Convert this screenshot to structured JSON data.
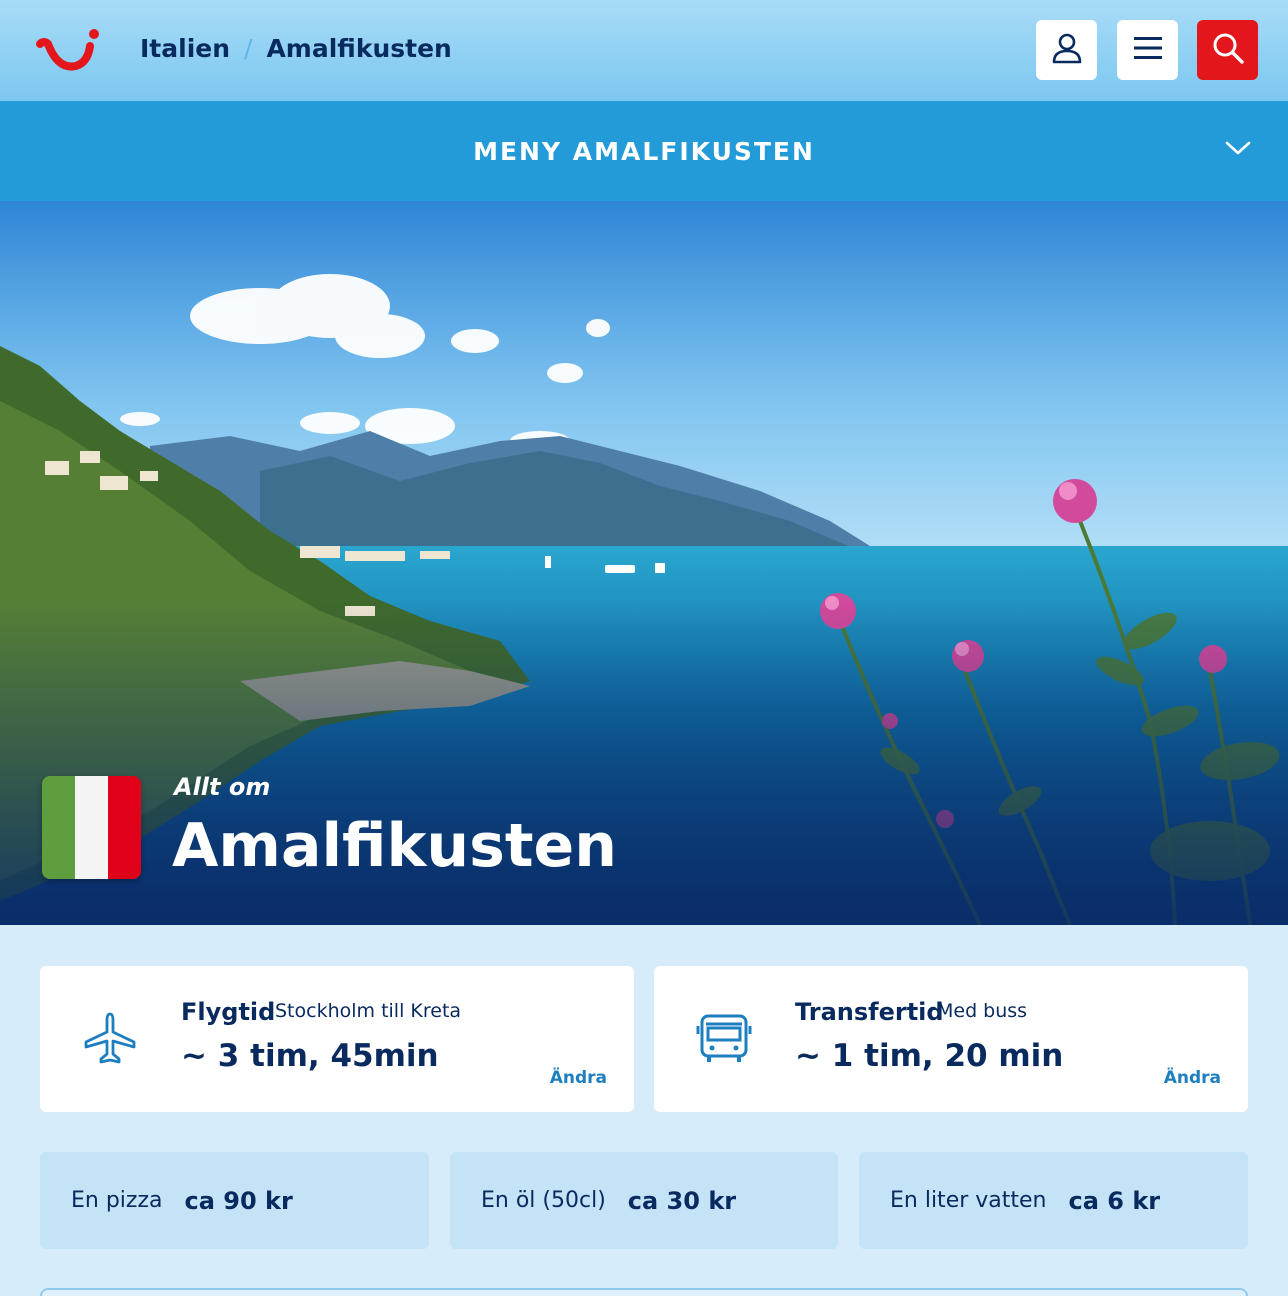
{
  "header": {
    "breadcrumb": [
      "Italien",
      "/",
      "Amalfikusten"
    ],
    "icons": {
      "logo": "tui-smile-logo",
      "user": "user-icon",
      "menu": "hamburger-icon",
      "search": "search-icon"
    },
    "colors": {
      "brand_red": "#e3161c",
      "navy": "#092a5e"
    }
  },
  "menubar": {
    "title": "MENY AMALFIKUSTEN",
    "icon": "chevron-down-icon",
    "color": "#239bd9"
  },
  "hero": {
    "kicker": "Allt om",
    "title": "Amalfikusten",
    "flag_colors": [
      "#5e9e3f",
      "#f4f4f4",
      "#e1001a"
    ]
  },
  "info": {
    "flight": {
      "label": "Flygtid",
      "sub": "Stockholm till Kreta",
      "value": "~ 3 tim, 45min",
      "change": "Ändra",
      "icon": "airplane-icon"
    },
    "transfer": {
      "label": "Transfertid",
      "sub": "Med buss",
      "value": "~ 1 tim, 20 min",
      "change": "Ändra",
      "icon": "bus-icon"
    }
  },
  "prices": [
    {
      "label": "En pizza",
      "value": "ca 90 kr"
    },
    {
      "label": "En öl (50cl)",
      "value": "ca 30 kr"
    },
    {
      "label": "En liter vatten",
      "value": "ca 6 kr"
    }
  ]
}
